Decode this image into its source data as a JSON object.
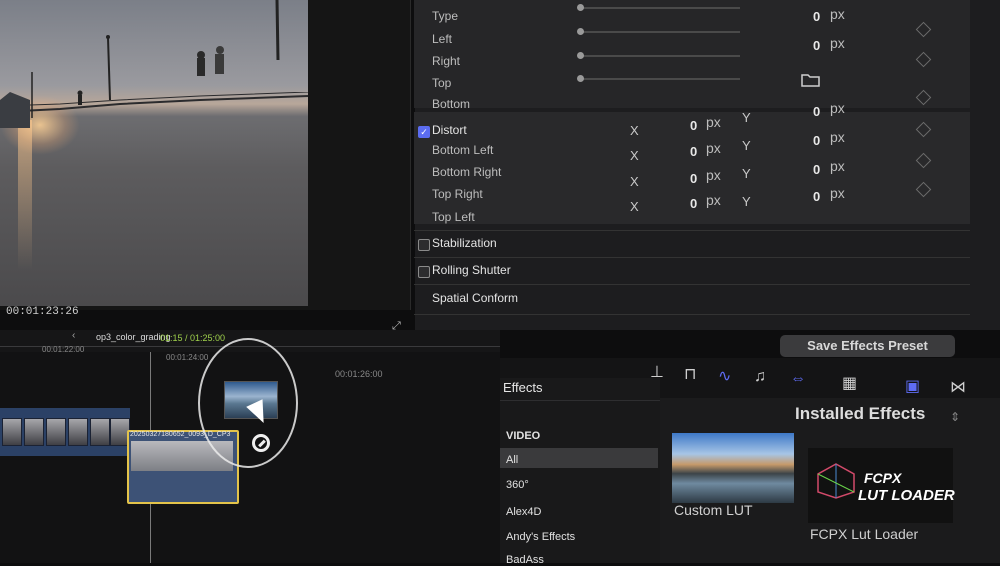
{
  "viewer": {
    "timecode": "00:01:23:26"
  },
  "inspector": {
    "crop_rows": [
      {
        "label": "Type",
        "value": "0",
        "unit": "px"
      },
      {
        "label": "Left",
        "value": "0",
        "unit": "px"
      },
      {
        "label": "Right"
      },
      {
        "label": "Top"
      },
      {
        "label": "Bottom"
      }
    ],
    "distort": {
      "label": "Distort",
      "checked": true,
      "rows": [
        {
          "label": "Bottom Left",
          "x_axis": "X",
          "x_value": "0",
          "x_unit": "px",
          "y_axis": "Y",
          "y_value": "0",
          "y_unit": "px"
        },
        {
          "label": "Bottom Right",
          "x_axis": "X",
          "x_value": "0",
          "x_unit": "px",
          "y_axis": "Y",
          "y_value": "0",
          "y_unit": "px"
        },
        {
          "label": "Top Right",
          "x_axis": "X",
          "x_value": "0",
          "x_unit": "px",
          "y_axis": "Y",
          "y_value": "0",
          "y_unit": "px"
        },
        {
          "label": "Top Left",
          "x_axis": "X",
          "x_value": "0",
          "x_unit": "px",
          "y_axis": "Y",
          "y_value": "0",
          "y_unit": "px"
        }
      ],
      "header_row": {
        "x_axis": "X",
        "x_value": "0",
        "x_unit": "px",
        "y_axis": "Y",
        "y_value": "0",
        "y_unit": "px"
      }
    },
    "stabilization": "Stabilization",
    "rolling_shutter": "Rolling Shutter",
    "spatial_conform": "Spatial Conform",
    "save_preset": "Save Effects Preset"
  },
  "timeline": {
    "project_name": "op3_color_grading",
    "project_time": "01:15 / 01:25:00",
    "ruler": [
      "00:01:22:00",
      "00:01:24:00",
      "00:01:26:00"
    ],
    "clip_name": "20250327180652_0093_D_CP3"
  },
  "effects": {
    "title": "Effects",
    "header": "VIDEO",
    "categories": [
      "All",
      "360°",
      "Alex4D",
      "Andy's Effects",
      "BadAss"
    ],
    "installed_label": "Installed Effects",
    "items": [
      {
        "name": "Custom LUT"
      },
      {
        "name": "FCPX Lut Loader",
        "thumb_line1": "FCPX",
        "thumb_line2": "LUT LOADER"
      }
    ]
  },
  "colors": {
    "accent": "#5b6cf0",
    "selection": "#e3c34a",
    "timecode_green": "#9fd14b"
  }
}
